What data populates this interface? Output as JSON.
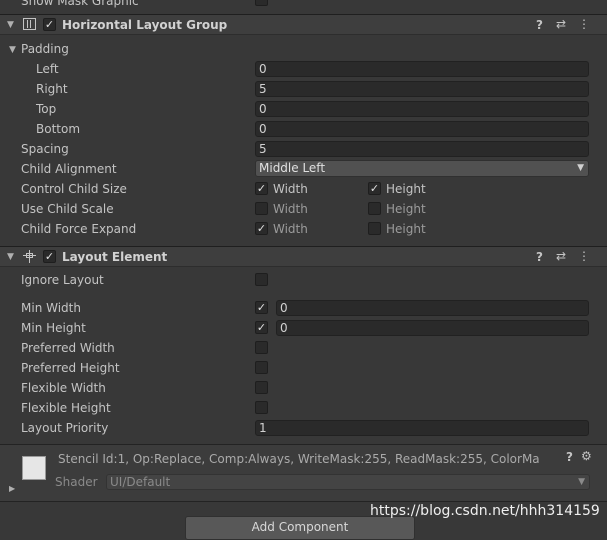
{
  "top": {
    "clipped_label": "Show Mask Graphic"
  },
  "hlg": {
    "title": "Horizontal Layout Group",
    "padding_label": "Padding",
    "left_label": "Left",
    "left_value": "0",
    "right_label": "Right",
    "right_value": "5",
    "top_label": "Top",
    "top_value": "0",
    "bottom_label": "Bottom",
    "bottom_value": "0",
    "spacing_label": "Spacing",
    "spacing_value": "5",
    "child_alignment_label": "Child Alignment",
    "child_alignment_value": "Middle Left",
    "control_child_size_label": "Control Child Size",
    "use_child_scale_label": "Use Child Scale",
    "child_force_expand_label": "Child Force Expand",
    "width_label": "Width",
    "height_label": "Height",
    "checks": {
      "control_width": true,
      "control_height": true,
      "scale_width": false,
      "scale_height": false,
      "expand_width": true,
      "expand_height": false
    }
  },
  "le": {
    "title": "Layout Element",
    "ignore_layout_label": "Ignore Layout",
    "min_width_label": "Min Width",
    "min_width_value": "0",
    "min_height_label": "Min Height",
    "min_height_value": "0",
    "preferred_width_label": "Preferred Width",
    "preferred_height_label": "Preferred Height",
    "flexible_width_label": "Flexible Width",
    "flexible_height_label": "Flexible Height",
    "layout_priority_label": "Layout Priority",
    "layout_priority_value": "1"
  },
  "material": {
    "info": "Stencil Id:1, Op:Replace, Comp:Always, WriteMask:255, ReadMask:255, ColorMa",
    "shader_label": "Shader",
    "shader_value": "UI/Default"
  },
  "add_component": "Add Component",
  "watermark": "https://blog.csdn.net/hhh314159",
  "glyphs": {
    "check": "✓",
    "help": "?",
    "settings": "⇄",
    "more": "⋮",
    "fold_open": "▼",
    "fold_closed": "▶",
    "arrow_down": "▼",
    "gear": "⚙"
  },
  "colors": {
    "background": "#383838",
    "header": "#3e3e3e",
    "field": "#2a2a2a",
    "text": "#c4c4c4"
  }
}
